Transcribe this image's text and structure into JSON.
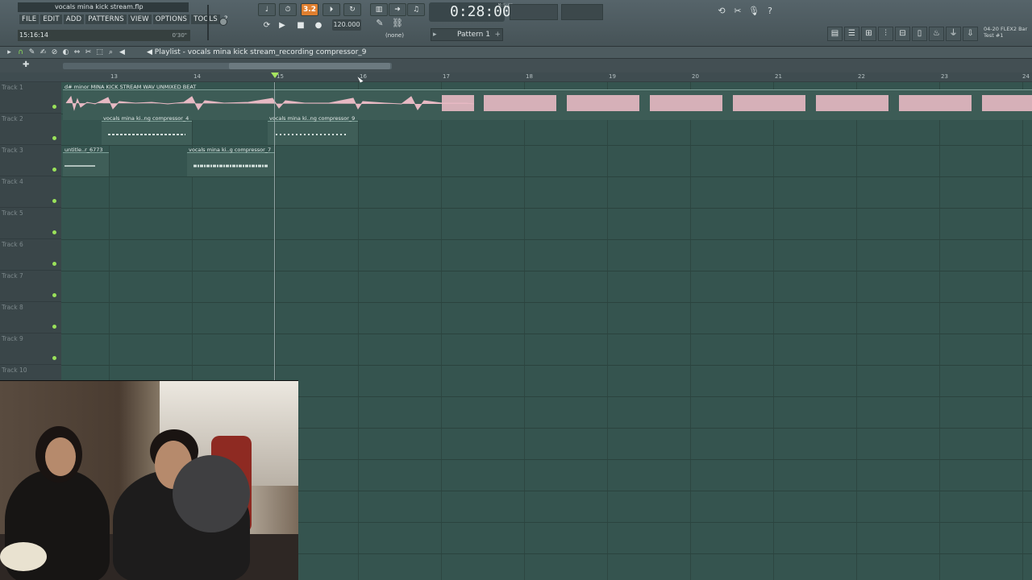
{
  "window": {
    "title": "vocals mina kick stream.flp"
  },
  "menu": [
    "FILE",
    "EDIT",
    "ADD",
    "PATTERNS",
    "VIEW",
    "OPTIONS",
    "TOOLS",
    "?"
  ],
  "hint": {
    "left": "15:16:14",
    "right": "0'30\""
  },
  "transport": {
    "time": "0:28:00",
    "time_unit": "M:S:CS",
    "tempo": "120.000",
    "snap": "(none)",
    "pattern": "Pattern 1",
    "record_mode_label": "3.2"
  },
  "flex": {
    "line1": "04-20  FLEX2 Bar",
    "line2": "Test #1"
  },
  "playlist": {
    "title": "Playlist - vocals mina kick stream_recording compressor_9",
    "ruler": [
      "13",
      "14",
      "15",
      "16",
      "17",
      "18",
      "19",
      "20",
      "21",
      "22",
      "23",
      "24"
    ],
    "tracks": [
      "Track 1",
      "Track 2",
      "Track 3",
      "Track 4",
      "Track 5",
      "Track 6",
      "Track 7",
      "Track 8",
      "Track 9",
      "Track 10"
    ],
    "clips": [
      {
        "label": "d# minor MINA KICK STREAM WAV UNMIXED BEAT",
        "track": 0
      },
      {
        "label": "vocals mina ki..ng compressor_4",
        "track": 1
      },
      {
        "label": "vocals mina ki..ng compressor_9",
        "track": 1
      },
      {
        "label": "untitle..r_6773",
        "track": 2
      },
      {
        "label": "vocals mina ki..g compressor_7",
        "track": 2
      }
    ]
  },
  "colors": {
    "grid_bg": "#35544f",
    "audio_clip": "#e7b9c3",
    "accent": "#e07f2f",
    "led": "#9ae25a"
  }
}
